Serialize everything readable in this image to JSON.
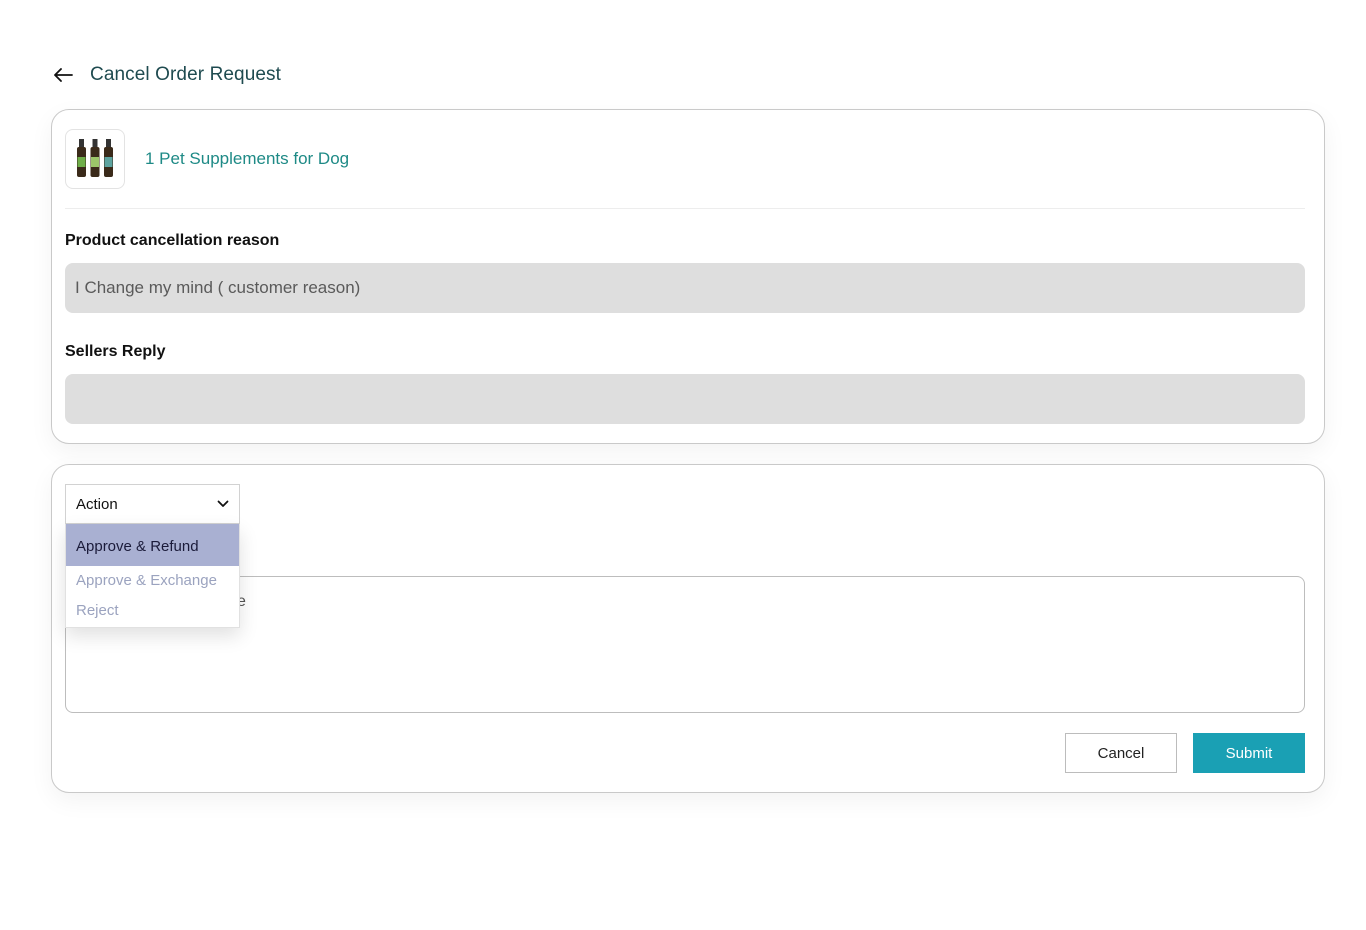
{
  "header": {
    "back_icon": "arrow-left-icon",
    "title": "Cancel Order Request"
  },
  "product": {
    "image_icon": "supplement-bottles-icon",
    "name": "1 Pet Supplements for Dog"
  },
  "cancellation_reason": {
    "label": "Product cancellation reason",
    "value": "I Change my mind ( customer reason)"
  },
  "sellers_reply": {
    "label": "Sellers Reply",
    "value": ""
  },
  "action": {
    "selected_label": "Action",
    "chevron_icon": "chevron-down-icon",
    "options": [
      {
        "label": "Approve & Refund",
        "highlighted": true
      },
      {
        "label": "Approve & Exchange",
        "highlighted": false
      },
      {
        "label": "Reject",
        "highlighted": false
      }
    ]
  },
  "message": {
    "visible_fragment": "e"
  },
  "buttons": {
    "cancel_label": "Cancel",
    "submit_label": "Submit"
  },
  "colors": {
    "title": "#1f4b50",
    "product_link": "#1e8a86",
    "submit_bg": "#1aa0b4",
    "dropdown_highlight": "#a9b0d2",
    "readonly_bg": "#dedede"
  }
}
